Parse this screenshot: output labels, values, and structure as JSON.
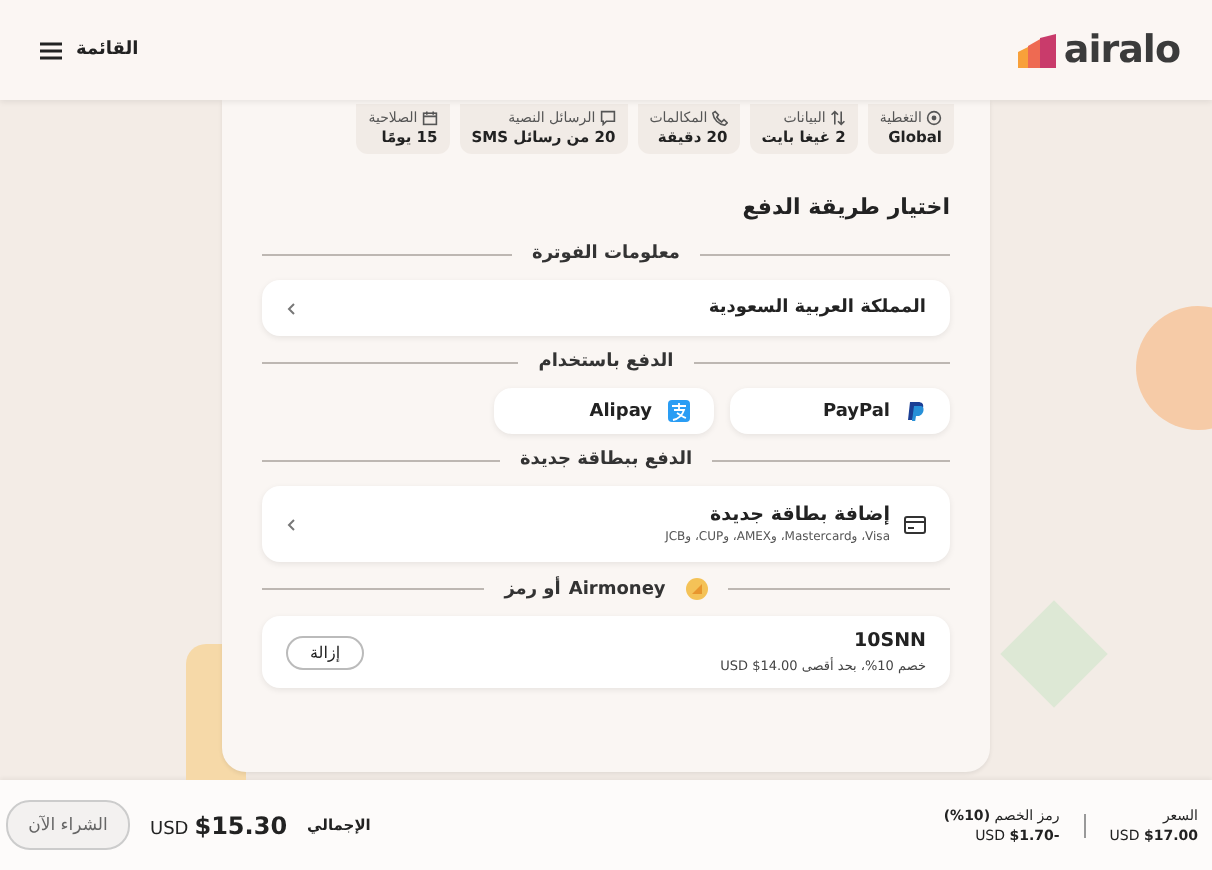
{
  "header": {
    "logo": "airalo",
    "menu_label": "القائمة"
  },
  "plan_specs": [
    {
      "kind": "coverage",
      "label": "التغطية",
      "value": "Global"
    },
    {
      "kind": "data",
      "label": "البيانات",
      "value": "2 غيغا بايت"
    },
    {
      "kind": "calls",
      "label": "المكالمات",
      "value": "20 دقيقة"
    },
    {
      "kind": "sms",
      "label": "الرسائل النصية",
      "value": "20 من رسائل SMS"
    },
    {
      "kind": "validity",
      "label": "الصلاحية",
      "value": "15 يومًا"
    }
  ],
  "title": "اختيار طريقة الدفع",
  "billing": {
    "heading": "معلومات الفوترة",
    "country": "المملكة العربية السعودية"
  },
  "pay_with": {
    "heading": "الدفع باستخدام",
    "methods": [
      {
        "kind": "paypal",
        "label": "PayPal"
      },
      {
        "kind": "alipay",
        "label": "Alipay"
      }
    ]
  },
  "new_card": {
    "heading": "الدفع ببطاقة جديدة",
    "title": "إضافة بطاقة جديدة",
    "brands": "Visa، وMastercard، وAMEX، وCUP، وJCB"
  },
  "promo": {
    "heading": "**Airmoney** أو رمز",
    "code": "10SNN",
    "description": "خصم 10%، بحد أقصى 14.00$ USD",
    "remove_button": "إزالة"
  },
  "summary": {
    "price_label": "السعر",
    "price": "USD **$17.00**",
    "discount_label": "رمز الخصم **(10%)**",
    "discount": "USD **$1.70-**",
    "total_label": "الإجمالي",
    "total_currency": "USD",
    "total_amount": "$15.30",
    "buy_button": "الشراء الآن"
  }
}
